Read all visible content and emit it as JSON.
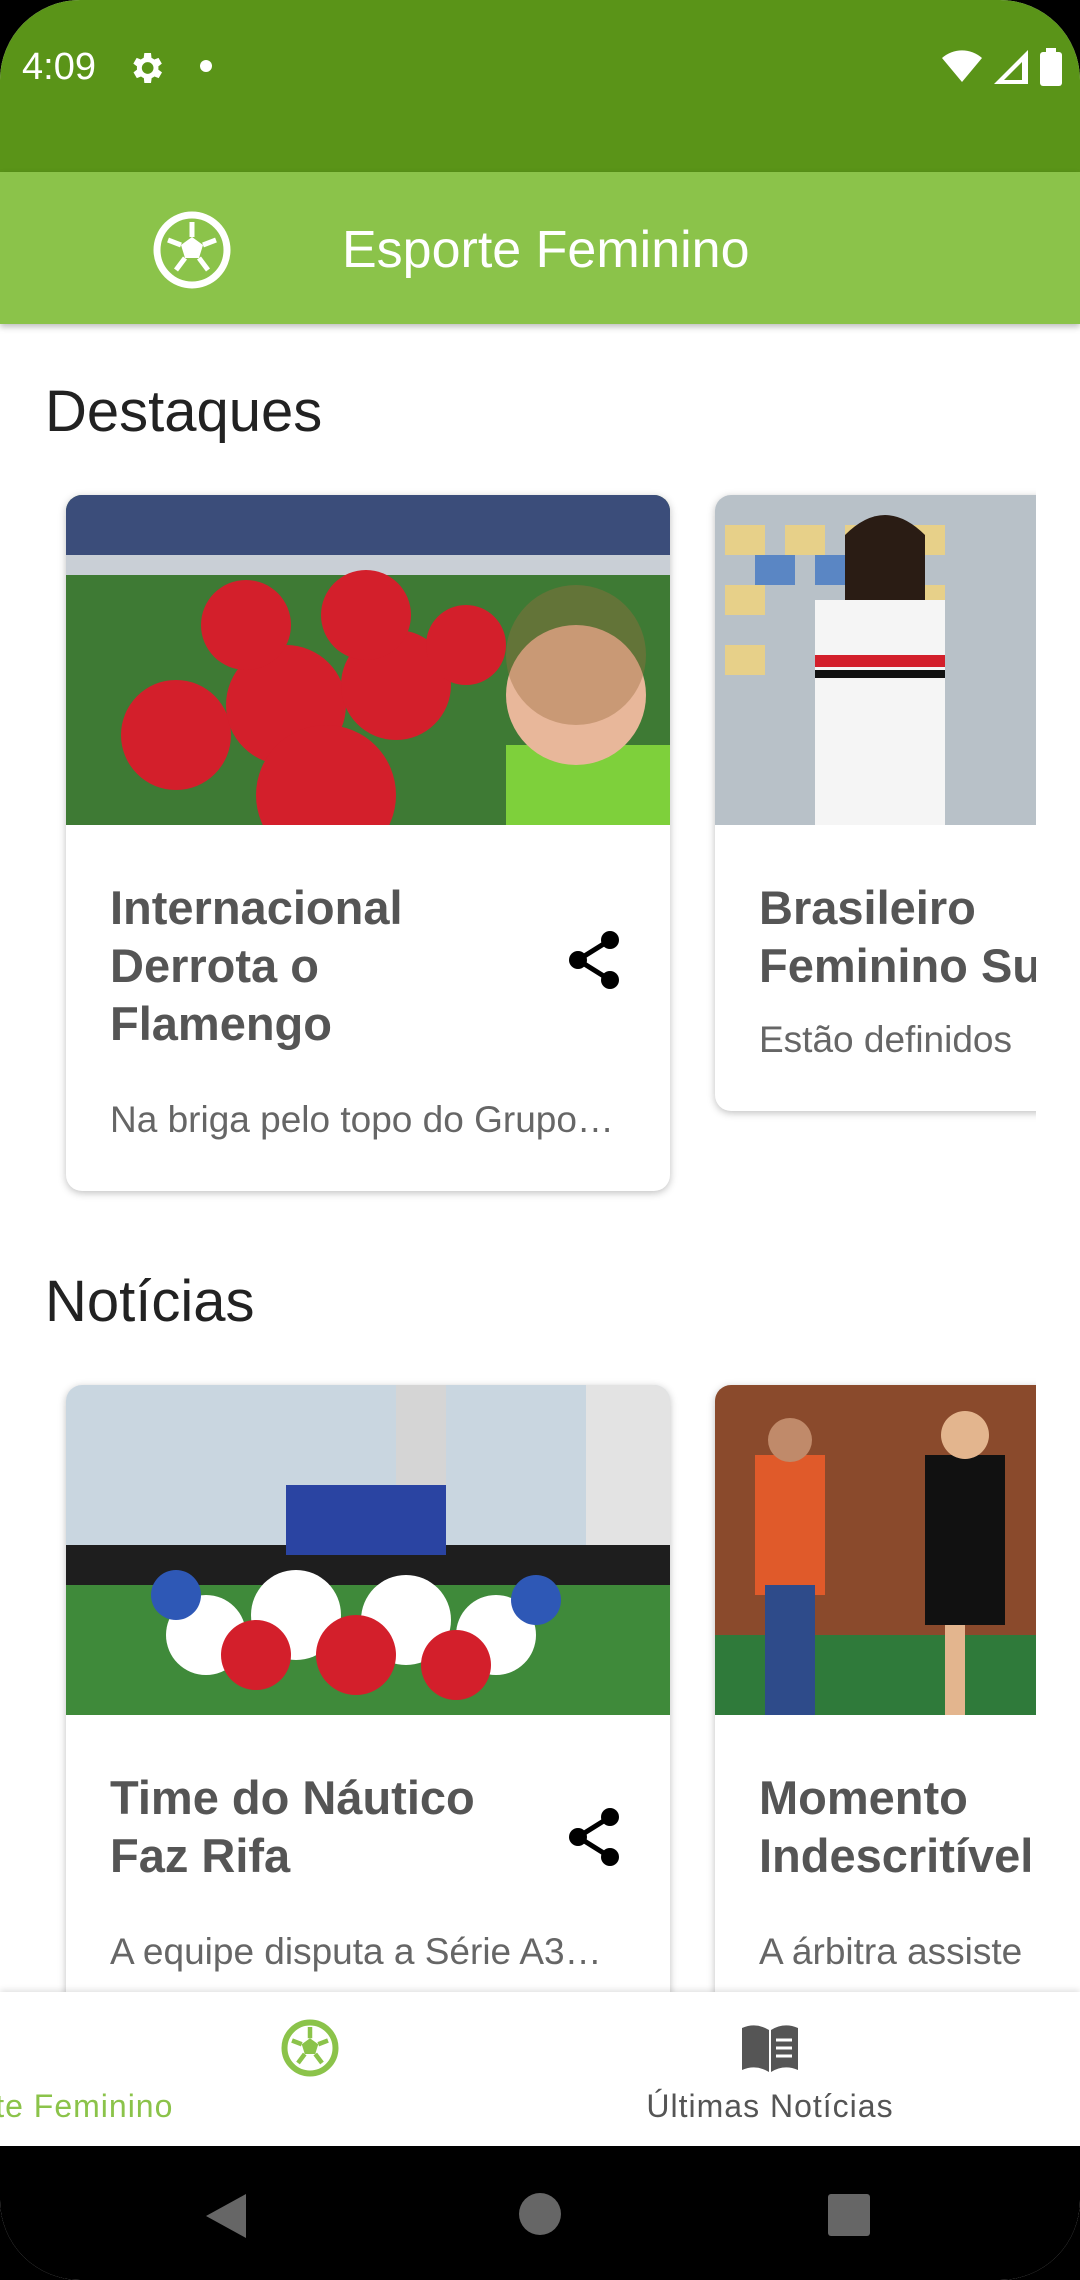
{
  "status": {
    "time": "4:09"
  },
  "appbar": {
    "title": "Esporte Feminino"
  },
  "sections": {
    "highlights": {
      "title": "Destaques",
      "cards": [
        {
          "title": "Internacional Derrota o Flamengo",
          "subtitle": "Na briga pelo topo do Grupo…"
        },
        {
          "title": "Brasileiro Feminino Su",
          "subtitle": "Estão definidos"
        }
      ]
    },
    "news": {
      "title": "Notícias",
      "cards": [
        {
          "title": "Time do Náutico Faz Rifa",
          "subtitle": "A equipe disputa a Série A3…"
        },
        {
          "title": "Momento Indescritível",
          "subtitle": "A árbitra assiste"
        }
      ]
    }
  },
  "bottom_nav": {
    "items": [
      {
        "label": "Esporte Feminino",
        "active": true
      },
      {
        "label": "Últimas Notícias",
        "active": false
      }
    ]
  },
  "colors": {
    "status_bar": "#5a9418",
    "app_bar": "#8bc34a",
    "active_nav": "#8bc34a",
    "inactive_nav": "#555555"
  },
  "icons": [
    "settings-icon",
    "wifi-icon",
    "signal-icon",
    "battery-icon",
    "soccer-ball-icon",
    "share-icon",
    "book-icon",
    "back-icon",
    "home-icon",
    "recents-icon"
  ]
}
